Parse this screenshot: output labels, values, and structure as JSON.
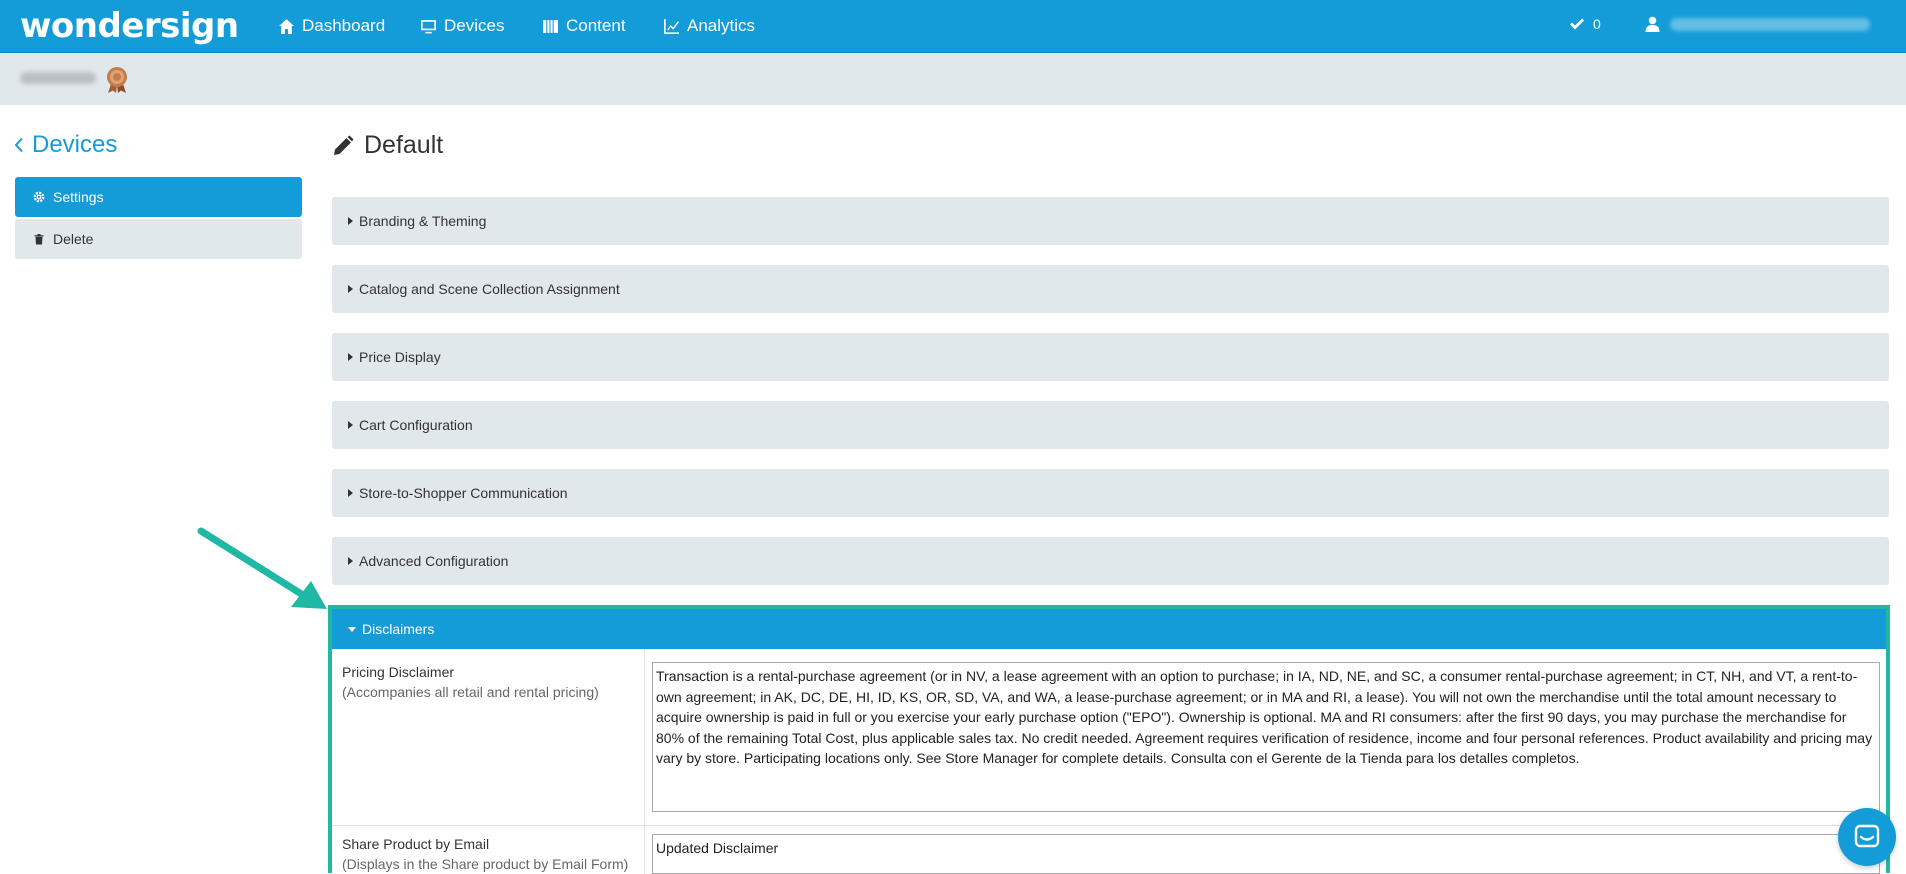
{
  "brand": "wondersign",
  "nav": {
    "dashboard": "Dashboard",
    "devices": "Devices",
    "content": "Content",
    "analytics": "Analytics",
    "check_count": "0"
  },
  "sidebar": {
    "back_label": "Devices",
    "settings": "Settings",
    "delete": "Delete"
  },
  "page": {
    "title": "Default"
  },
  "sections": [
    "Branding & Theming",
    "Catalog and Scene Collection Assignment",
    "Price Display",
    "Cart Configuration",
    "Store-to-Shopper Communication",
    "Advanced Configuration"
  ],
  "disclaimers": {
    "header": "Disclaimers",
    "pricing_label": "Pricing Disclaimer",
    "pricing_sub": "(Accompanies all retail and rental pricing)",
    "pricing_value": "Transaction is a rental-purchase agreement (or in NV, a lease agreement with an option to purchase; in IA, ND, NE, and SC, a consumer rental-purchase agreement; in CT, NH, and VT, a rent-to-own agreement; in AK, DC, DE, HI, ID, KS, OR, SD, VA, and WA, a lease-purchase agreement; or in MA and RI, a lease). You will not own the merchandise until the total amount necessary to acquire ownership is paid in full or you exercise your early purchase option (\"EPO\"). Ownership is optional. MA and RI consumers: after the first 90 days, you may purchase the merchandise for 80% of the remaining Total Cost, plus applicable sales tax. No credit needed. Agreement requires verification of residence, income and four personal references. Product availability and pricing may vary by store. Participating locations only. See Store Manager for complete details. Consulta con el Gerente de la Tienda para los detalles completos.",
    "share_label": "Share Product by Email",
    "share_sub": "(Displays in the Share product by Email Form)",
    "share_value": "Updated Disclaimer"
  },
  "colors": {
    "primary": "#139cd8",
    "panel": "#e1e8ec",
    "annotation": "#1fb8a4"
  }
}
